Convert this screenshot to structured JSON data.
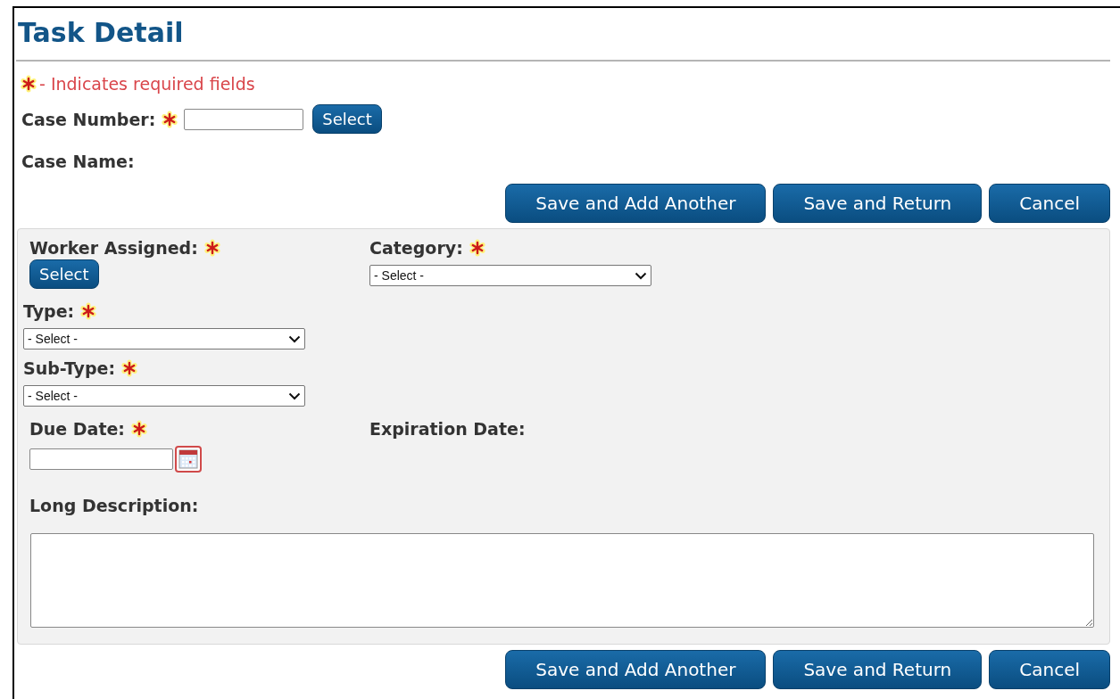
{
  "title": "Task Detail",
  "required_note": {
    "text": "- Indicates required fields"
  },
  "case_number": {
    "label": "Case Number:",
    "required": true,
    "button": "Select"
  },
  "case_name": {
    "label": "Case Name:"
  },
  "top_actions": [
    "Save and Add Another",
    "Save and Return",
    "Cancel"
  ],
  "panel": {
    "worker_assigned": {
      "label": "Worker Assigned:",
      "required": true,
      "button": "Select"
    },
    "category": {
      "label": "Category:",
      "required": true,
      "value": "- Select -"
    },
    "type": {
      "label": "Type:",
      "required": true,
      "value": "- Select -"
    },
    "sub_type": {
      "label": "Sub-Type:",
      "required": true,
      "value": "- Select -"
    },
    "due_date": {
      "label": "Due Date:",
      "required": true
    },
    "expiration_date": {
      "label": "Expiration Date:"
    },
    "long_description": {
      "label": "Long Description:"
    }
  },
  "bottom_actions": [
    "Save and Add Another",
    "Save and Return",
    "Cancel"
  ]
}
